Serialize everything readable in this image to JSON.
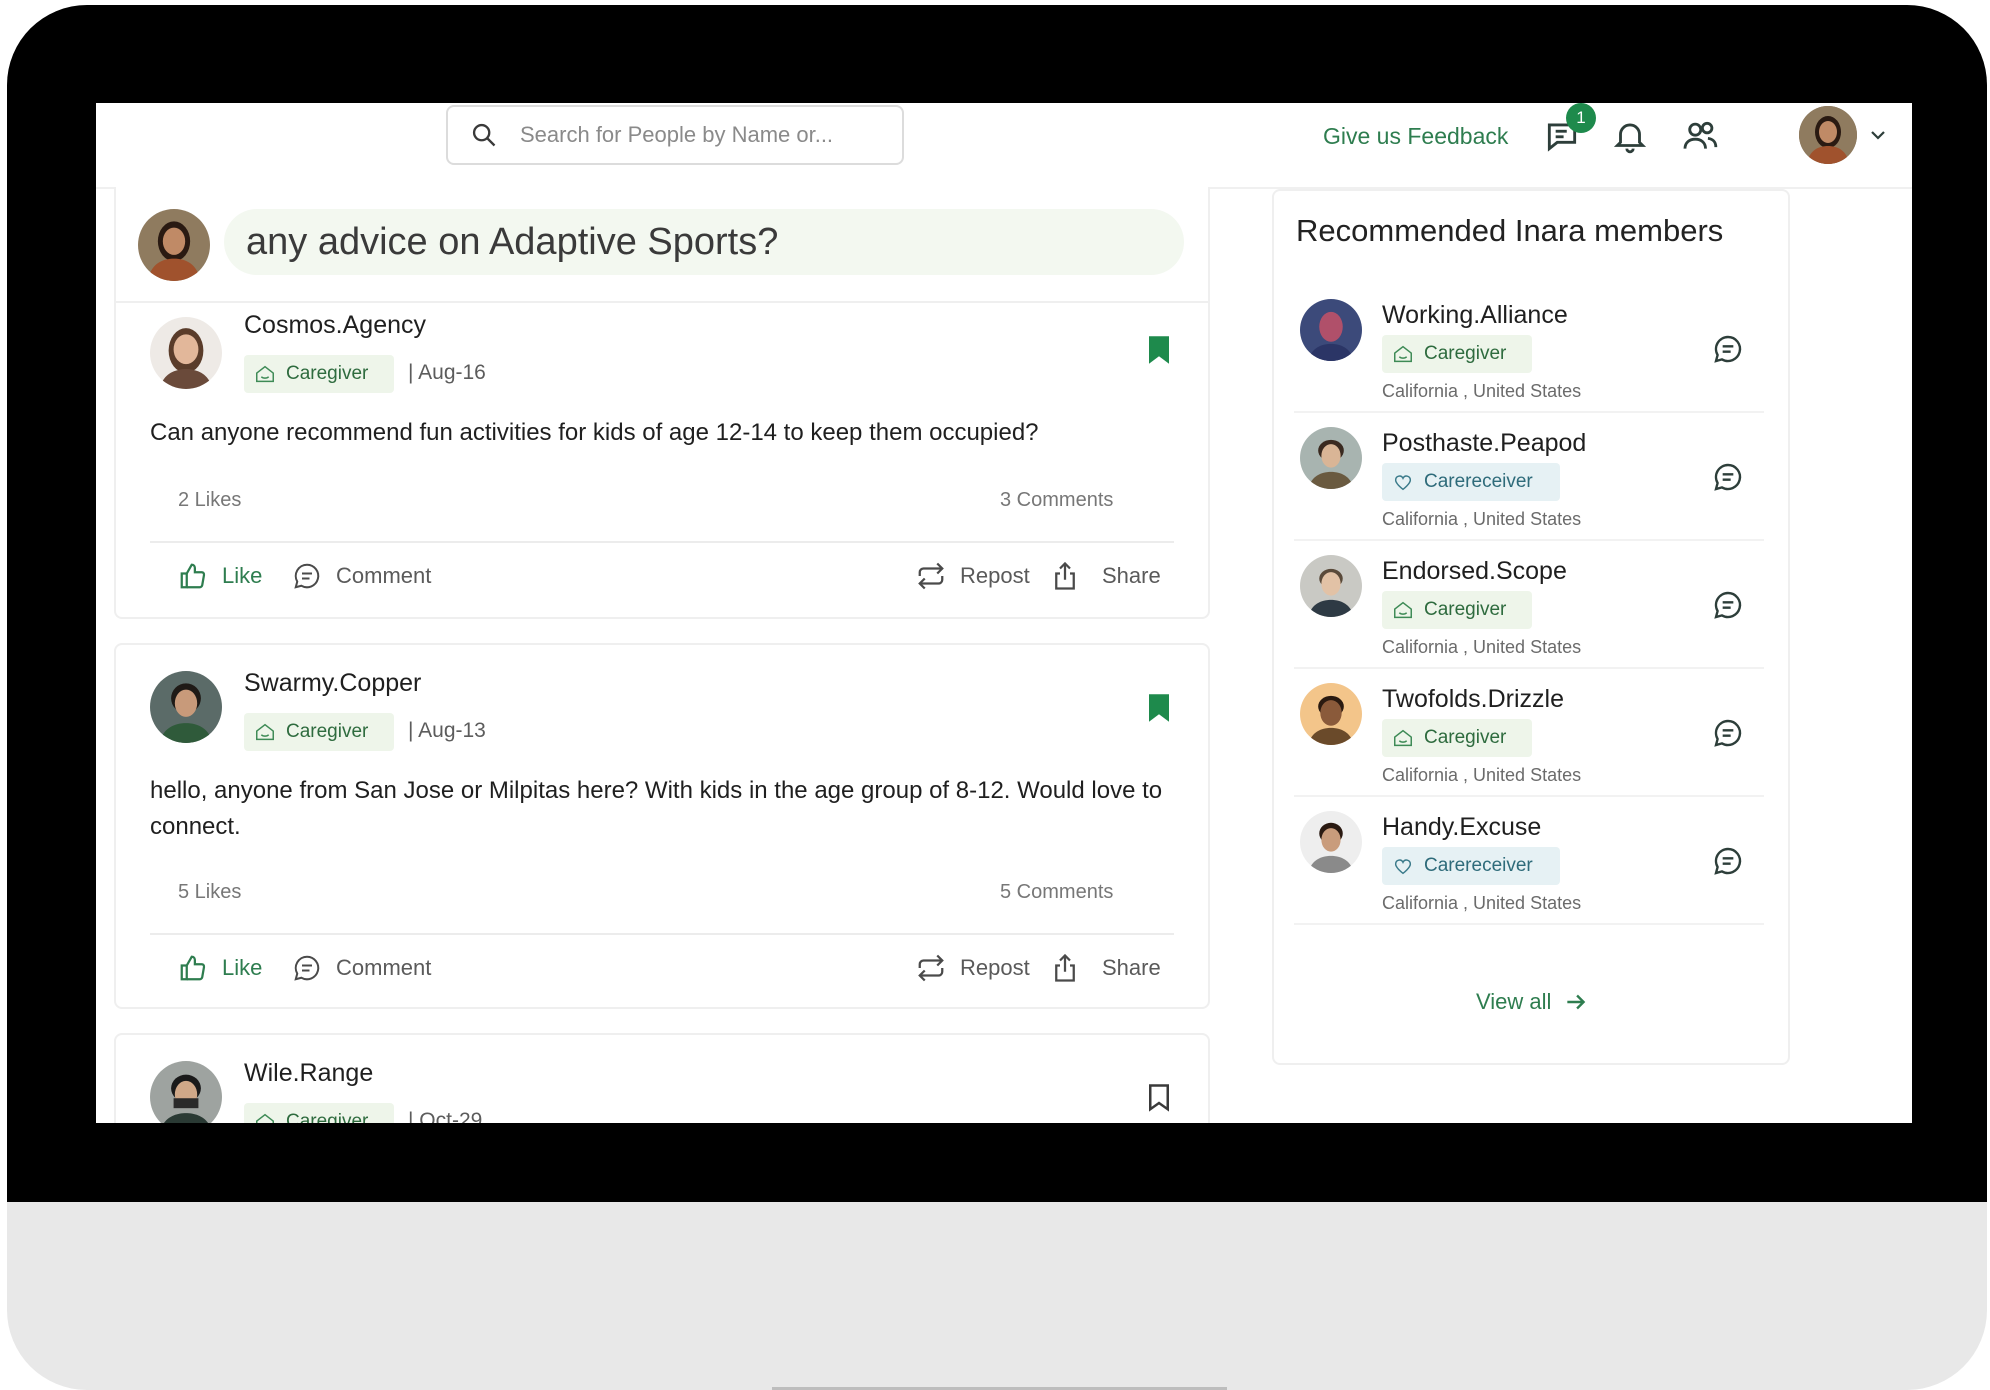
{
  "header": {
    "search_placeholder": "Search for People by Name or...",
    "feedback_label": "Give us Feedback",
    "message_badge": "1",
    "icons": [
      "search-icon",
      "message-icon",
      "bell-icon",
      "people-icon",
      "chevron-down-icon"
    ]
  },
  "composer": {
    "prompt": "any advice on Adaptive Sports?"
  },
  "posts": [
    {
      "author": "Cosmos.Agency",
      "role": "Caregiver",
      "date": "| Aug-16",
      "text": "Can anyone recommend fun activities for kids of age 12-14 to keep them occupied?",
      "likes": "2 Likes",
      "comments": "3 Comments",
      "bookmarked": true
    },
    {
      "author": "Swarmy.Copper",
      "role": "Caregiver",
      "date": "| Aug-13",
      "text": "hello, anyone from San Jose or Milpitas here? With kids in the age group of 8-12. Would love to connect.",
      "likes": "5 Likes",
      "comments": "5 Comments",
      "bookmarked": true
    },
    {
      "author": "Wile.Range",
      "role": "Caregiver",
      "date": "| Oct-29",
      "bookmarked": false
    }
  ],
  "actions": {
    "like": "Like",
    "comment": "Comment",
    "repost": "Repost",
    "share": "Share"
  },
  "recommended": {
    "title": "Recommended Inara members",
    "members": [
      {
        "name": "Working.Alliance",
        "role": "Caregiver",
        "location": "California , United States"
      },
      {
        "name": "Posthaste.Peapod",
        "role": "Carereceiver",
        "location": "California , United States"
      },
      {
        "name": "Endorsed.Scope",
        "role": "Caregiver",
        "location": "California , United States"
      },
      {
        "name": "Twofolds.Drizzle",
        "role": "Caregiver",
        "location": "California , United States"
      },
      {
        "name": "Handy.Excuse",
        "role": "Carereceiver",
        "location": "California , United States"
      }
    ],
    "view_all": "View all"
  },
  "colors": {
    "accent": "#2e7d4f",
    "tag_green_bg": "#eef5ea",
    "tag_blue_bg": "#e6f1f4",
    "composer_bg": "#f3f8f0",
    "bezel": "#000000"
  }
}
